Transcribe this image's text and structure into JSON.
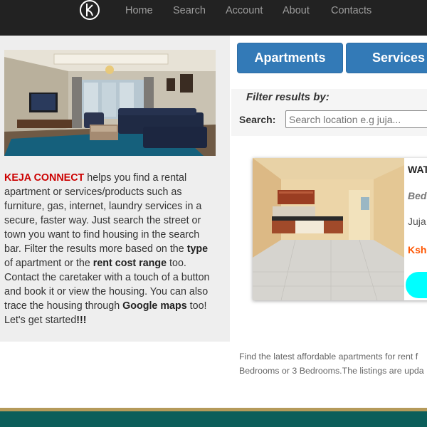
{
  "nav": {
    "links": [
      "Home",
      "Search",
      "Account",
      "About",
      "Contacts"
    ]
  },
  "intro": {
    "brand": "KEJA CONNECT",
    "part1": " helps you find a rental apartment or services/products such as furniture, gas, internet, laundry services in a secure, faster way. Just search the street or town you want to find housing in the search bar. Filter the results more based on the ",
    "type_bold": "type",
    "part2": " of apartment or the ",
    "rent_bold": "rent cost range",
    "part3": " too. Contact the caretaker with a touch of a button and book it or view the housing. You can also trace the housing through ",
    "maps_bold": "Google maps",
    "part4": " too! Let's get started",
    "exclaim_bold": "!!!"
  },
  "tabs": {
    "apartments": "Apartments",
    "services": "Services"
  },
  "filter": {
    "title": "Filter results by:",
    "search_label": "Search:",
    "search_placeholder": "Search location e.g juja..."
  },
  "listing": {
    "title": "WAT",
    "beds": "Beds",
    "location": "Juja",
    "price": "Ksh"
  },
  "description": {
    "line1": "Find the latest affordable apartments for rent f",
    "line2": "Bedrooms or 3 Bedrooms.The listings are upda"
  },
  "colors": {
    "nav_bg": "#222222",
    "tab_blue": "#337ab7",
    "brand_red": "#cc0000",
    "price_orange": "#ff5500",
    "cta_cyan": "#00ffff",
    "footer_teal": "#0b5e5a",
    "footer_accent": "#b59a5a"
  }
}
